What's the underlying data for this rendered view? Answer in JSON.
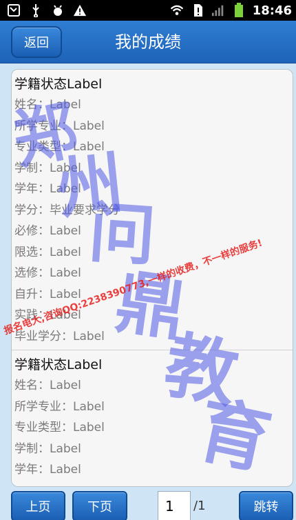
{
  "status_bar": {
    "time": "18:46",
    "icons": [
      "missed-call-icon",
      "usb-icon",
      "android-debug-icon",
      "warning-icon",
      "wifi-icon",
      "sim-alert-icon",
      "signal-icon",
      "battery-icon"
    ]
  },
  "header": {
    "back_label": "返回",
    "title": "我的成绩"
  },
  "records": [
    {
      "title": "学籍状态Label",
      "fields": [
        "姓名：Label",
        "所学专业：Label",
        "专业类型：Label",
        "学制：Label",
        "学年：Label",
        "学分：毕业要求学分",
        "必修：Label",
        "限选：Label",
        "选修：Label",
        "自升：Label",
        "实践：Label",
        "毕业学分：Label"
      ]
    },
    {
      "title": "学籍状态Label",
      "fields": [
        "姓名：Label",
        "所学专业：Label",
        "专业类型：Label",
        "学制：Label",
        "学年：Label"
      ]
    }
  ],
  "footer": {
    "prev_label": "上页",
    "next_label": "下页",
    "page_value": "1",
    "page_total": "/1",
    "jump_label": "跳转"
  },
  "watermark": {
    "chars": [
      "郑",
      "州",
      "问",
      "鼎",
      "教",
      "育"
    ],
    "line": "报名电大,咨询QQ:2238390773,一样的收费，不一样的服务!"
  },
  "colors": {
    "title_bar": "#1e63b8",
    "content_bg": "#cfe4f5",
    "watermark_blue": "#505ae6",
    "watermark_red": "#e61e1e"
  }
}
